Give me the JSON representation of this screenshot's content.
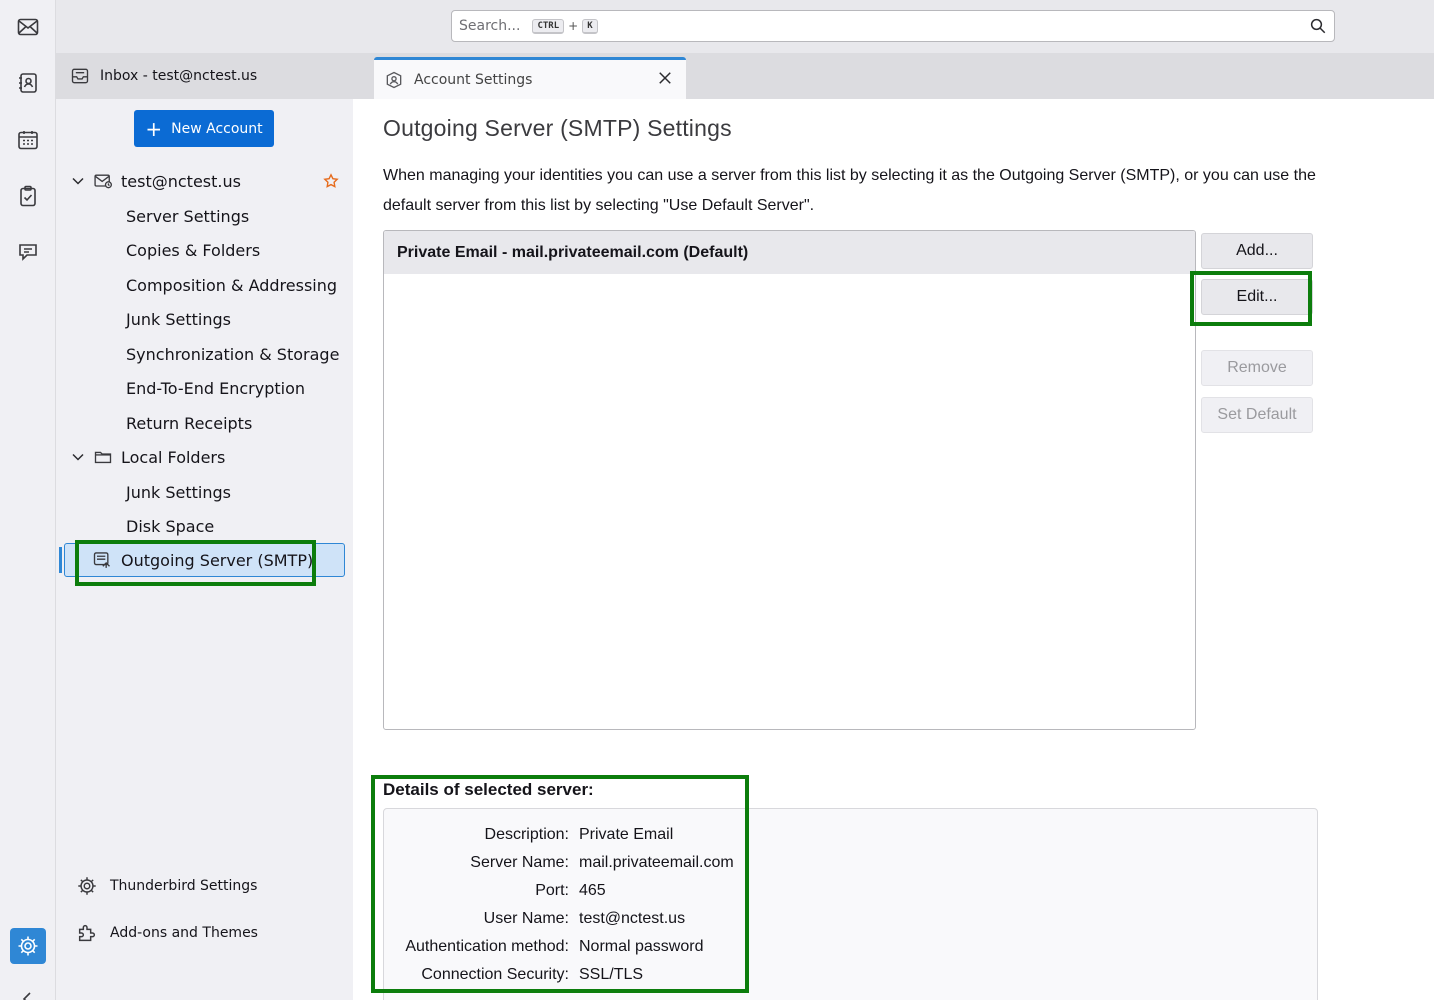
{
  "search": {
    "placeholder": "Search...",
    "shortcut_ctrl": "CTRL",
    "shortcut_plus": "+",
    "shortcut_key": "K"
  },
  "tabs": [
    {
      "label": "Inbox - test@nctest.us"
    },
    {
      "label": "Account Settings"
    }
  ],
  "sidebar": {
    "new_account_label": "New Account",
    "account": {
      "name": "test@nctest.us",
      "items": [
        "Server Settings",
        "Copies & Folders",
        "Composition & Addressing",
        "Junk Settings",
        "Synchronization & Storage",
        "End-To-End Encryption",
        "Return Receipts"
      ]
    },
    "local": {
      "name": "Local Folders",
      "items": [
        "Junk Settings",
        "Disk Space"
      ]
    },
    "selected_label": "Outgoing Server (SMTP)",
    "footer": {
      "settings_label": "Thunderbird Settings",
      "addons_label": "Add-ons and Themes"
    }
  },
  "main": {
    "title": "Outgoing Server (SMTP) Settings",
    "description": "When managing your identities you can use a server from this list by selecting it as the Outgoing Server (SMTP), or you can use the default server from this list by selecting \"Use Default Server\".",
    "servers": [
      "Private Email - mail.privateemail.com (Default)"
    ],
    "buttons": {
      "add": "Add...",
      "edit": "Edit...",
      "remove": "Remove",
      "set_default": "Set Default"
    },
    "details_title": "Details of selected server:",
    "details": [
      {
        "k": "Description:",
        "v": "Private Email"
      },
      {
        "k": "Server Name:",
        "v": "mail.privateemail.com"
      },
      {
        "k": "Port:",
        "v": "465"
      },
      {
        "k": "User Name:",
        "v": "test@nctest.us"
      },
      {
        "k": "Authentication method:",
        "v": "Normal password"
      },
      {
        "k": "Connection Security:",
        "v": "SSL/TLS"
      }
    ]
  },
  "colors": {
    "accent": "#2f87d5",
    "primary_button": "#0b6bd4",
    "highlight_box": "#0c7d0c"
  }
}
